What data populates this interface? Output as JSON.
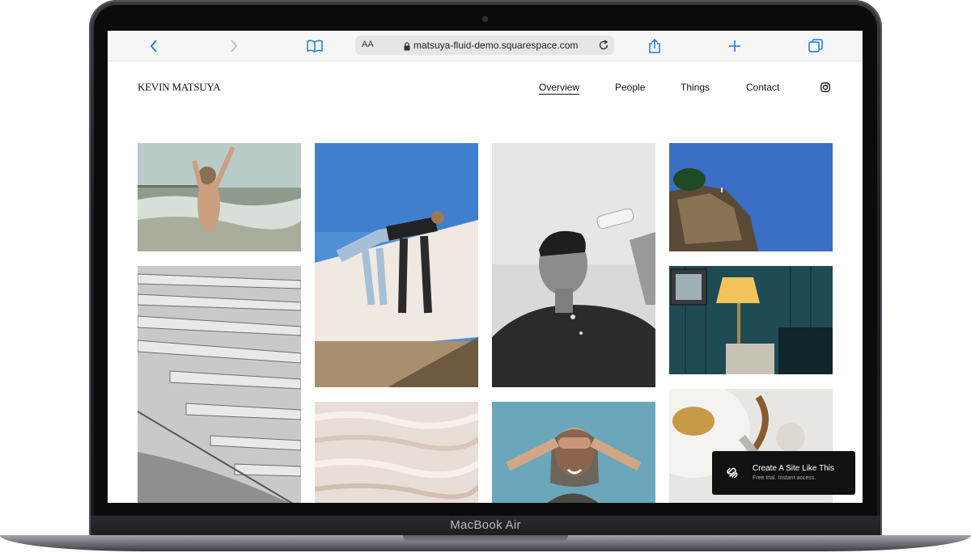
{
  "device": {
    "label": "MacBook Air"
  },
  "browser": {
    "text_size_label": "AA",
    "url": "matsuya-fluid-demo.squarespace.com",
    "icons": [
      "chevron-left-icon",
      "chevron-right-icon",
      "book-icon",
      "lock-icon",
      "reload-icon",
      "share-icon",
      "plus-icon",
      "tabs-icon"
    ]
  },
  "site": {
    "title": "KEVIN MATSUYA",
    "nav": [
      {
        "label": "Overview",
        "active": true
      },
      {
        "label": "People",
        "active": false
      },
      {
        "label": "Things",
        "active": false
      },
      {
        "label": "Contact",
        "active": false
      }
    ],
    "social_icon": "instagram-icon"
  },
  "gallery": {
    "photos": [
      "beach-jump-photo",
      "bleachers-photo",
      "wall-climb-photo",
      "travertine-photo",
      "water-splash-portrait-photo",
      "covered-eyes-portrait-photo",
      "cliff-sky-photo",
      "lamp-room-photo",
      "teapot-photo"
    ]
  },
  "cta": {
    "title": "Create A Site Like This",
    "subtitle": "Free trial. Instant access.",
    "icon": "squarespace-logo-icon"
  },
  "colors": {
    "accent": "#1a7cd6",
    "dark": "#111111"
  }
}
